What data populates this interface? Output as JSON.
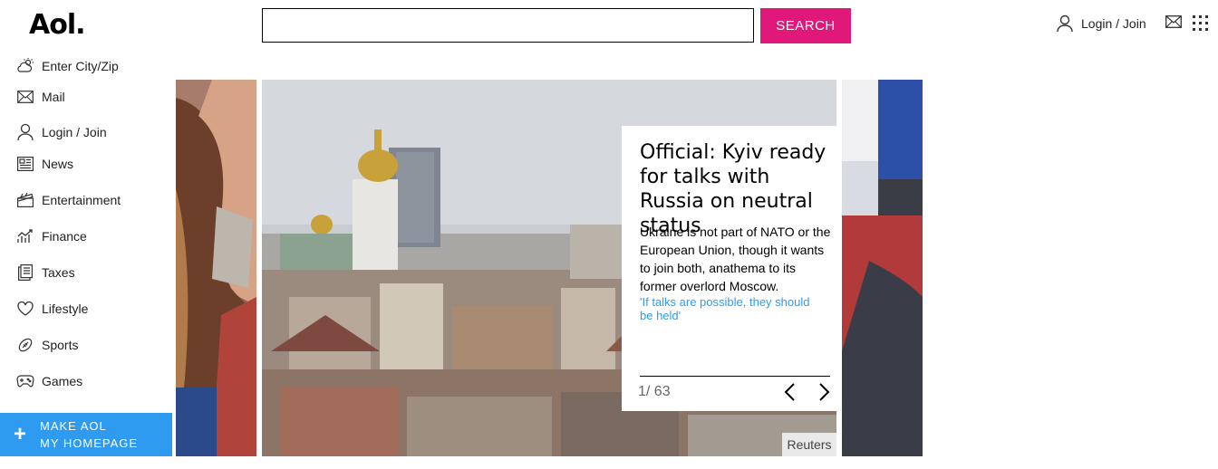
{
  "header": {
    "logo": "Aol.",
    "search": {
      "value": "",
      "placeholder": ""
    },
    "search_button": "SEARCH",
    "login_label": "Login / Join",
    "icons": {
      "user": "user-icon",
      "mail": "mail-icon",
      "apps": "apps-grid-icon"
    }
  },
  "sidebar": {
    "items": [
      {
        "label": "Enter City/Zip",
        "icon": "weather-icon"
      },
      {
        "label": "Mail",
        "icon": "mail-icon"
      },
      {
        "label": "Login / Join",
        "icon": "user-icon"
      },
      {
        "label": "News",
        "icon": "news-icon"
      },
      {
        "label": "Entertainment",
        "icon": "clapperboard-icon"
      },
      {
        "label": "Finance",
        "icon": "finance-chart-icon"
      },
      {
        "label": "Taxes",
        "icon": "taxes-document-icon"
      },
      {
        "label": "Lifestyle",
        "icon": "heart-icon"
      },
      {
        "label": "Sports",
        "icon": "football-icon"
      },
      {
        "label": "Games",
        "icon": "gamepad-icon"
      }
    ],
    "homepage_button": {
      "line1": "MAKE AOL",
      "line2": "MY HOMEPAGE",
      "icon": "plus-icon"
    }
  },
  "carousel": {
    "title": "Official: Kyiv ready for talks with Russia on neutral status",
    "summary": "Ukraine is not part of NATO or the European Union, though it wants to join both, anathema to its former overlord Moscow.",
    "related_link": "'If talks are possible, they should be held'",
    "counter": "1/ 63",
    "credit": "Reuters",
    "colors": {
      "accent_search": "#e0187a",
      "accent_blue": "#2f9bf0"
    }
  }
}
